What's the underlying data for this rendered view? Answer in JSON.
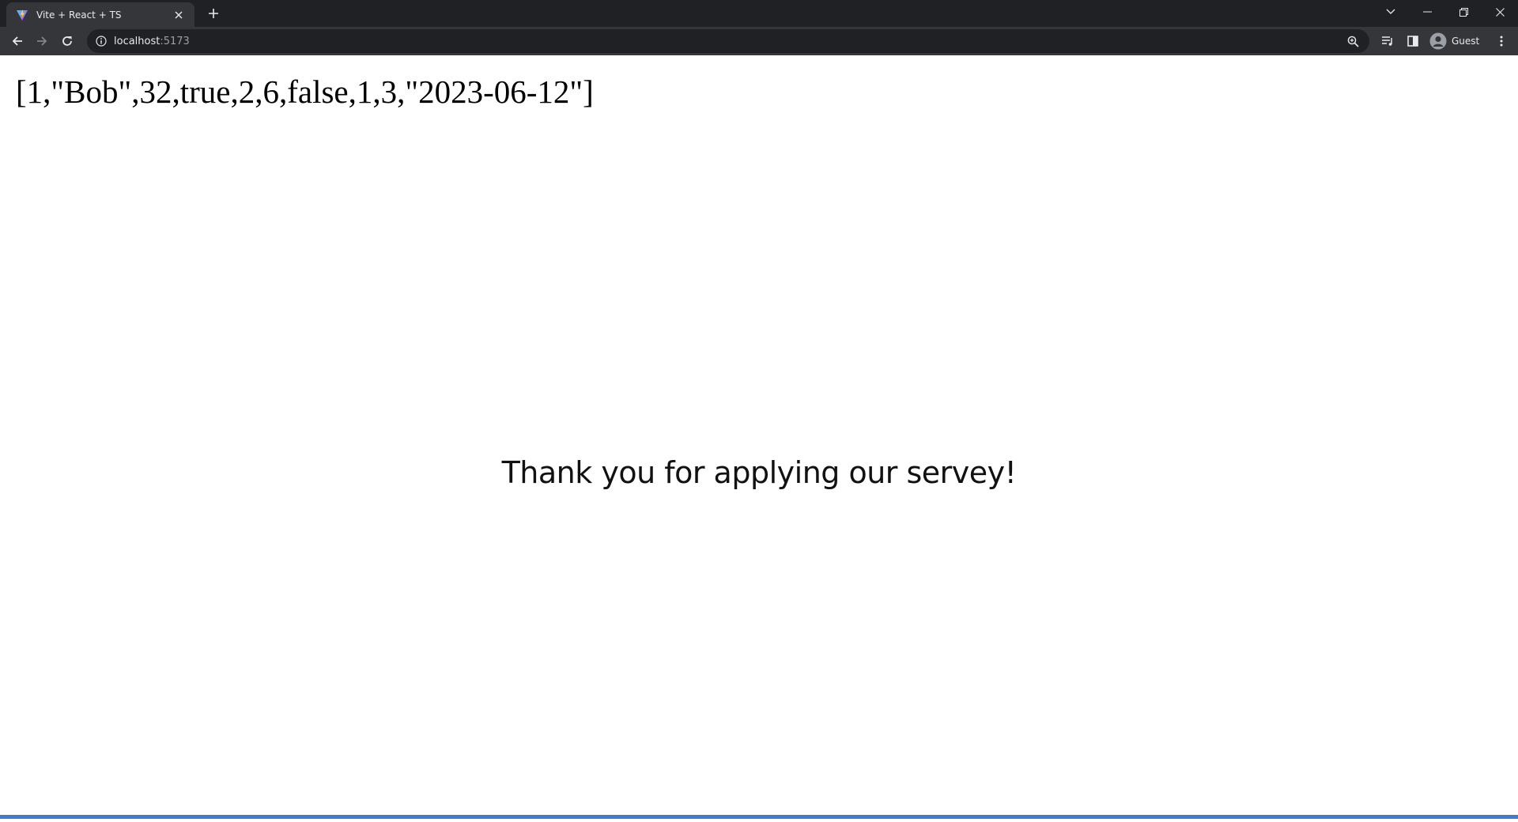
{
  "browser": {
    "tab": {
      "title": "Vite + React + TS",
      "favicon": "vite-logo-icon"
    },
    "address": {
      "host": "localhost",
      "port": ":5173"
    },
    "profile": {
      "label": "Guest"
    },
    "colors": {
      "tabstrip": "#202124",
      "toolbar": "#35363a",
      "omnibox": "#202124",
      "accent": "#3c7bd0"
    }
  },
  "page": {
    "json_output": "[1,\"Bob\",32,true,2,6,false,1,3,\"2023-06-12\"]",
    "message": "Thank you for applying our servey!"
  }
}
